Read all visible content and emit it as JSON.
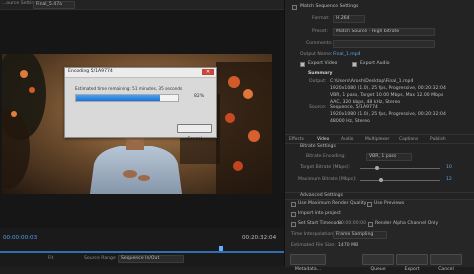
{
  "source_panel": {
    "label": "...ource Setting",
    "clip_name": "Final_5.47a"
  },
  "dialog": {
    "title": "Encoding 5/1A9774",
    "time_text": "Estimated time remaining: 51 minutes, 35 seconds",
    "progress_percent": 82,
    "progress_label": "82%",
    "cancel_label": "Cancel"
  },
  "timeline": {
    "current_timecode": "00:00:00:03",
    "end_timecode": "00:20:32:04",
    "fit_label": "Fit",
    "bottom_labels": {
      "source_range": "Source Range",
      "sequence_in_out": "Sequence In/Out"
    }
  },
  "export_settings": {
    "match_sequence": "Match Sequence Settings",
    "format": {
      "label": "Format:",
      "value": "H.264"
    },
    "preset": {
      "label": "Preset:",
      "value": "Match Source - High bitrate"
    },
    "comments": {
      "label": "Comments:"
    },
    "output_name": {
      "label": "Output Name:",
      "value": "Final_1.mp4"
    },
    "export_video": "Export Video",
    "export_audio": "Export Audio",
    "summary": {
      "heading": "Summary",
      "output": {
        "label": "Output:",
        "lines": [
          "C:\\Users\\Arosh\\Desktop\\Final_1.mp4",
          "1920x1080 (1.0), 25 fps, Progressive, 00:20:32:04",
          "VBR, 1 pass, Target 10.00 Mbps, Max 12.00 Mbps",
          "AAC, 320 kbps, 48 kHz, Stereo"
        ]
      },
      "source": {
        "label": "Source:",
        "lines": [
          "Sequence, 5/1A9774",
          "1920x1080 (1.0), 25 fps, Progressive, 00:20:32:04",
          "48000 Hz, Stereo"
        ]
      }
    },
    "tabs": [
      "Effects",
      "Video",
      "Audio",
      "Multiplexer",
      "Captions",
      "Publish"
    ],
    "bitrate_settings": "Bitrate Settings",
    "bitrate_encoding": {
      "label": "Bitrate Encoding:",
      "value": "VBR, 1 pass"
    },
    "target_bitrate": {
      "label": "Target Bitrate [Mbps]:",
      "value": "10"
    },
    "max_bitrate": {
      "label": "Maximum Bitrate [Mbps]:",
      "value": "12"
    },
    "advanced_settings": "Advanced Settings",
    "use_max_render_quality": "Use Maximum Render Quality",
    "use_previews": "Use Previews",
    "import_into_project": "Import into project",
    "set_start_timecode": "Set Start Timecode",
    "set_start_timecode_value": "00:00:00:00",
    "render_alpha": "Render Alpha Channel Only",
    "time_interpolation": {
      "label": "Time Interpolation:",
      "value": "Frame Sampling"
    },
    "estimated_file_size": {
      "label": "Estimated File Size:",
      "value": "1470 MB"
    },
    "buttons": {
      "metadata": "Metadata...",
      "queue": "Queue",
      "export": "Export",
      "cancel": "Cancel"
    }
  }
}
